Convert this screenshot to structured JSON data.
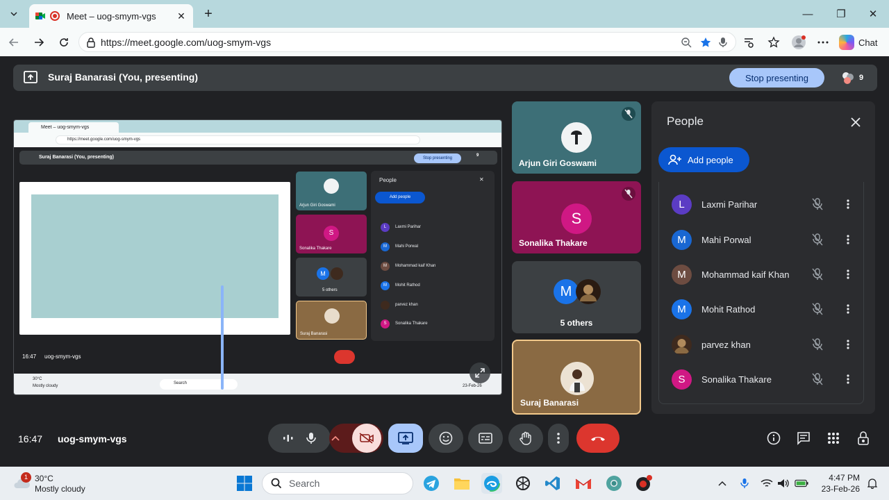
{
  "browser": {
    "tab_title": "Meet – uog-smym-vgs",
    "url": "https://meet.google.com/uog-smym-vgs",
    "chat_label": "Chat"
  },
  "meet": {
    "presenting_text": "Suraj Banarasi (You, presenting)",
    "stop_presenting_label": "Stop presenting",
    "participant_count": "9",
    "time": "16:47",
    "meeting_code": "uog-smym-vgs",
    "tiles": [
      {
        "name": "Arjun Giri Goswami",
        "muted": true
      },
      {
        "name": "Sonalika Thakare",
        "initial": "S",
        "muted": true
      },
      {
        "name": "5 others",
        "initial": "M"
      },
      {
        "name": "Suraj Banarasi"
      }
    ],
    "people_panel": {
      "title": "People",
      "add_people_label": "Add people",
      "list": [
        {
          "initial": "L",
          "name": "Laxmi Parihar",
          "color": "#5b3cc4"
        },
        {
          "initial": "M",
          "name": "Mahi Porwal",
          "color": "#1967d2"
        },
        {
          "initial": "M",
          "name": "Mohammad kaif Khan",
          "color": "#6d4c41"
        },
        {
          "initial": "M",
          "name": "Mohit Rathod",
          "color": "#1a73e8"
        },
        {
          "initial": "",
          "name": "parvez khan",
          "color": "#3e2a1e"
        },
        {
          "initial": "S",
          "name": "Sonalika Thakare",
          "color": "#d01884"
        }
      ]
    }
  },
  "shared_screen": {
    "tab_title": "Meet – uog-smym-vgs",
    "url": "https://meet.google.com/uog-smym-vgs",
    "presenting_text": "Suraj Banarasi (You, presenting)",
    "stop_presenting_label": "Stop presenting",
    "count": "9",
    "people_title": "People",
    "add_people_label": "Add people",
    "tiles": [
      "Arjun Giri Goswami",
      "Sonalika Thakare",
      "5 others",
      "Suraj Banarasi"
    ],
    "list": [
      "Laxmi Parihar",
      "Mahi Porwal",
      "Mohammad kaif Khan",
      "Mohit Rathod",
      "parvez khan",
      "Sonalika Thakare"
    ],
    "time": "16:47",
    "meeting_code": "uog-smym-vgs",
    "weather_temp": "30°C",
    "weather_desc": "Mostly cloudy",
    "search": "Search",
    "date": "23-Feb-26"
  },
  "taskbar": {
    "weather_badge": "1",
    "weather_temp": "30°C",
    "weather_desc": "Mostly cloudy",
    "search_placeholder": "Search",
    "time": "4:47 PM",
    "date": "23-Feb-26"
  },
  "colors": {
    "meet_bg": "#202124",
    "accent_blue": "#a8c7fa",
    "end_call_red": "#dc362e",
    "sonalika_tile": "#8e1454",
    "arjun_tile": "#3d6f77",
    "suraj_tile": "#8a6a43"
  }
}
